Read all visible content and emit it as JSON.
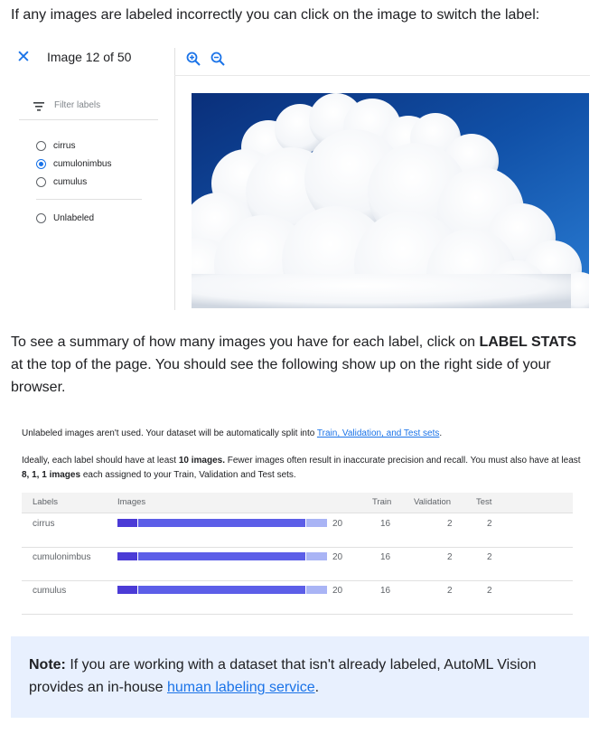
{
  "intro": {
    "text": "If any images are labeled incorrectly you can click on the image to switch the label:"
  },
  "dialog": {
    "title": "Image 12 of 50",
    "filter_placeholder": "Filter labels",
    "labels": [
      {
        "name": "cirrus",
        "checked": false
      },
      {
        "name": "cumulonimbus",
        "checked": true
      },
      {
        "name": "cumulus",
        "checked": false
      }
    ],
    "unlabeled": "Unlabeled",
    "icons": [
      "close-icon",
      "zoom-in-icon",
      "zoom-out-icon",
      "filter-icon"
    ],
    "accent_color": "#1a73e8"
  },
  "summary": {
    "text_before": "To see a summary of how many images you have for each label, click on ",
    "bold": "LABEL STATS",
    "text_after": " at the top of the page. You should see the following show up on the right side of your browser."
  },
  "stats": {
    "line1_before": "Unlabeled images aren't used. Your dataset will be automatically split into ",
    "line1_link": "Train, Validation, and Test sets",
    "line1_after": ".",
    "line2_before": "Ideally, each label should have at least ",
    "line2_bold1": "10 images.",
    "line2_mid": " Fewer images often result in inaccurate precision and recall. You must also have at least ",
    "line2_bold2": "8, 1, 1 images",
    "line2_after": " each assigned to your Train, Validation and Test sets.",
    "headers": {
      "labels": "Labels",
      "images": "Images",
      "train": "Train",
      "validation": "Validation",
      "test": "Test"
    },
    "rows": [
      {
        "label": "cirrus",
        "images": "20",
        "train": "16",
        "validation": "2",
        "test": "2"
      },
      {
        "label": "cumulonimbus",
        "images": "20",
        "train": "16",
        "validation": "2",
        "test": "2"
      },
      {
        "label": "cumulus",
        "images": "20",
        "train": "16",
        "validation": "2",
        "test": "2"
      }
    ],
    "bar_colors": {
      "dark": "#4b3bd6",
      "mid": "#5c5ee8",
      "light": "#a9b4f5"
    }
  },
  "note": {
    "bold": "Note:",
    "text": " If you are working with a dataset that isn't already labeled, AutoML Vision provides an in-house ",
    "link": "human labeling service",
    "after": "."
  }
}
